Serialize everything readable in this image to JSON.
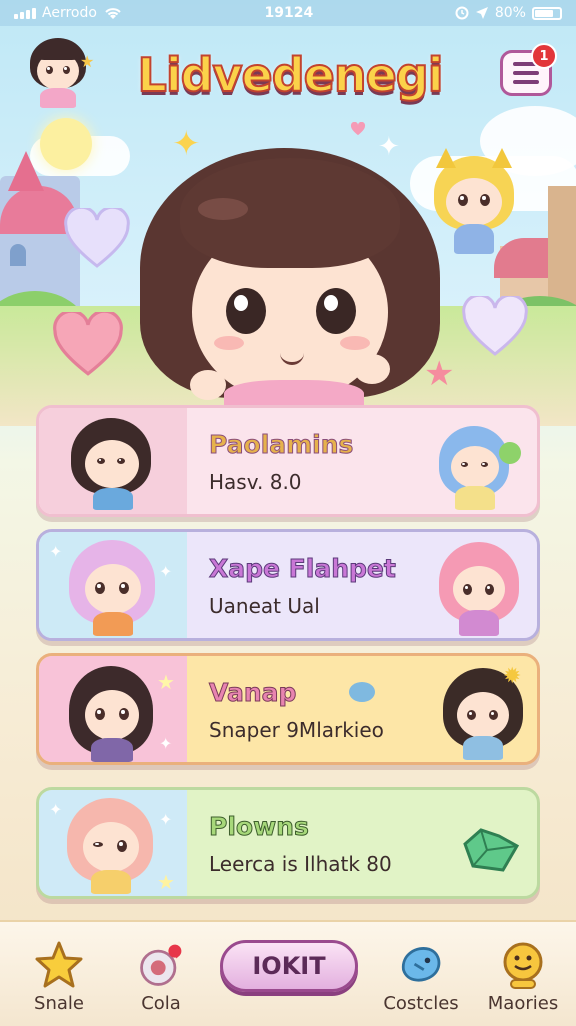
{
  "status_bar": {
    "carrier": "Aerrodo",
    "time": "19124",
    "battery": "80%"
  },
  "header": {
    "title": "Lidvedenegi",
    "menu_badge": "1"
  },
  "cards": [
    {
      "title": "Paolamins",
      "subtitle": "Hasv. 8.0",
      "bg": "#fbe4ec",
      "accent": "#f6c2d2",
      "title_color": "#e6b24c"
    },
    {
      "title": "Xape Flahpet",
      "subtitle": "Uaneat Ual",
      "bg": "#ece6fa",
      "accent": "#cdeaf6",
      "title_color": "#c977d6"
    },
    {
      "title": "Vanap",
      "subtitle": "Snaper 9Mlarkieo",
      "bg": "#fde6a7",
      "accent": "#f8c3d8",
      "title_color": "#e884b0"
    },
    {
      "title": "Plowns",
      "subtitle": "Leerca is Ilhatk 80",
      "bg": "#e1f3c6",
      "accent": "#cfeaf7",
      "title_color": "#a7d87a"
    }
  ],
  "bottom_nav": {
    "items": [
      {
        "label": "Snale",
        "icon": "star-icon"
      },
      {
        "label": "Cola",
        "icon": "ornament-icon"
      },
      {
        "label": "Costcles",
        "icon": "bird-icon"
      },
      {
        "label": "Maories",
        "icon": "smiley-icon"
      }
    ],
    "play_label": "IOKIT"
  }
}
